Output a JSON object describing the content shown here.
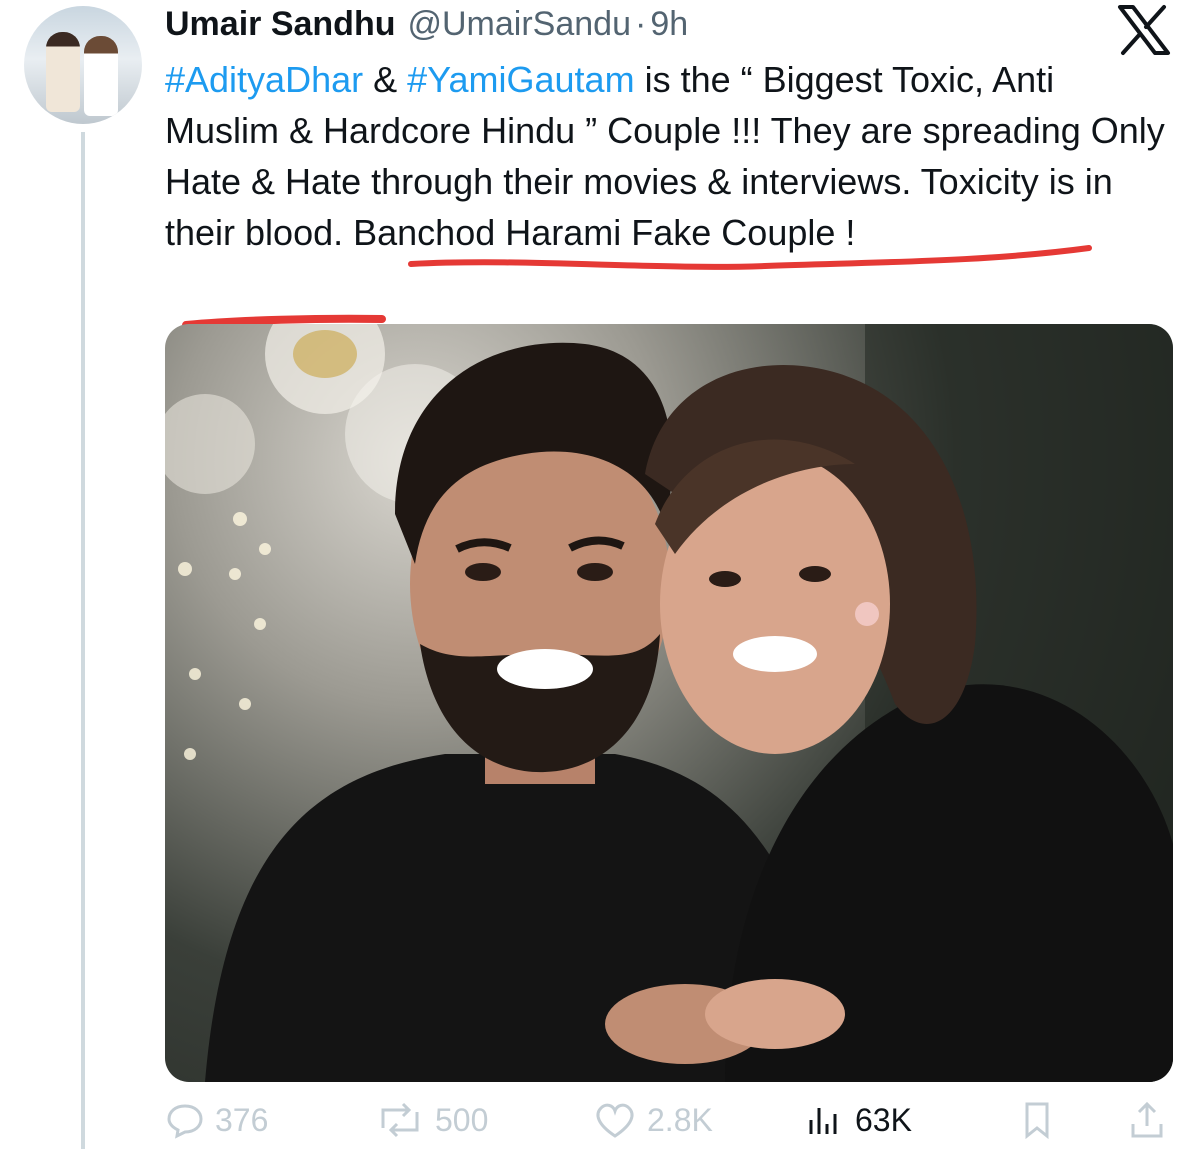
{
  "user": {
    "display_name": "Umair Sandhu",
    "handle": "@UmairSandu",
    "separator": "·",
    "time": "9h"
  },
  "tweet": {
    "hashtag_1": "#AdityaDhar",
    "text_1": " & ",
    "hashtag_2": "#YamiGautam",
    "text_2": " is the “ Biggest Toxic, Anti Muslim & Hardcore Hindu ” Couple !!! They are spreading Only Hate & Hate through their movies & interviews. Toxicity is in their blood. Banchod Harami Fake Couple !"
  },
  "actions": {
    "replies": "376",
    "reposts": "500",
    "likes": "2.8K",
    "views": "63K"
  },
  "icons": [
    "x-logo-icon",
    "reply-icon",
    "repost-icon",
    "like-icon",
    "views-icon",
    "bookmark-icon",
    "share-icon"
  ],
  "colors": {
    "hashtag": "#1d9bf0",
    "annotation_underline": "#e53935",
    "muted": "#536471"
  }
}
